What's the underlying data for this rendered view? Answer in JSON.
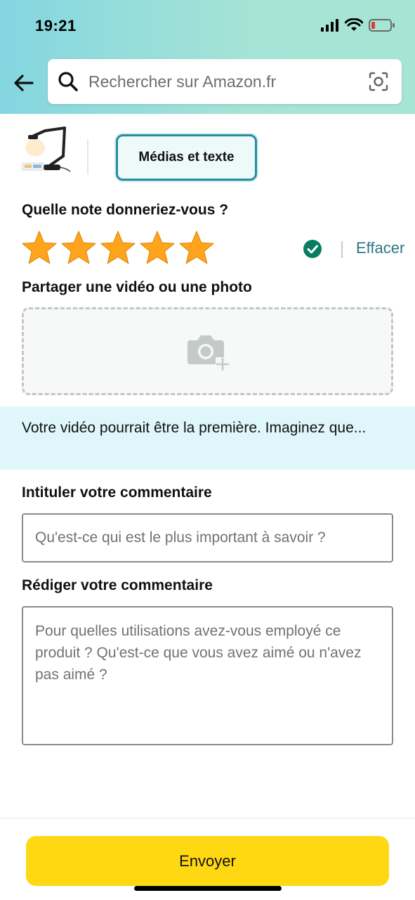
{
  "status_bar": {
    "time": "19:21",
    "icons": [
      "signal-icon",
      "wifi-icon",
      "battery-low-icon"
    ]
  },
  "header": {
    "back_icon": "arrow-left-icon",
    "search": {
      "placeholder": "Rechercher sur Amazon.fr",
      "value": "",
      "icon": "search-icon",
      "camera_icon": "camera-scan-icon"
    }
  },
  "product": {
    "thumbnail_icon": "desk-lamp-product-thumbnail",
    "tab_label": "Médias et texte"
  },
  "rating": {
    "label": "Quelle note donneriez-vous ?",
    "value": 5,
    "max": 5,
    "confirmed_icon": "check-circle-icon",
    "clear_label": "Effacer"
  },
  "media": {
    "label": "Partager une vidéo ou une photo",
    "upload_icon": "add-photo-icon"
  },
  "promo": {
    "text": "Votre vidéo pourrait être la première. Imaginez que..."
  },
  "title_field": {
    "label": "Intituler votre commentaire",
    "placeholder": "Qu'est-ce qui est le plus important à savoir ?",
    "value": ""
  },
  "review_field": {
    "label": "Rédiger votre commentaire",
    "placeholder": "Pour quelles utilisations avez-vous employé ce produit ? Qu'est-ce que vous avez aimé ou n'avez pas aimé ?",
    "value": ""
  },
  "submit": {
    "label": "Envoyer"
  },
  "colors": {
    "accent_teal": "#2a8ba0",
    "star_gold": "#ffa41c",
    "button_yellow": "#ffd814",
    "check_green": "#067d62",
    "link_teal": "#2a7886"
  }
}
